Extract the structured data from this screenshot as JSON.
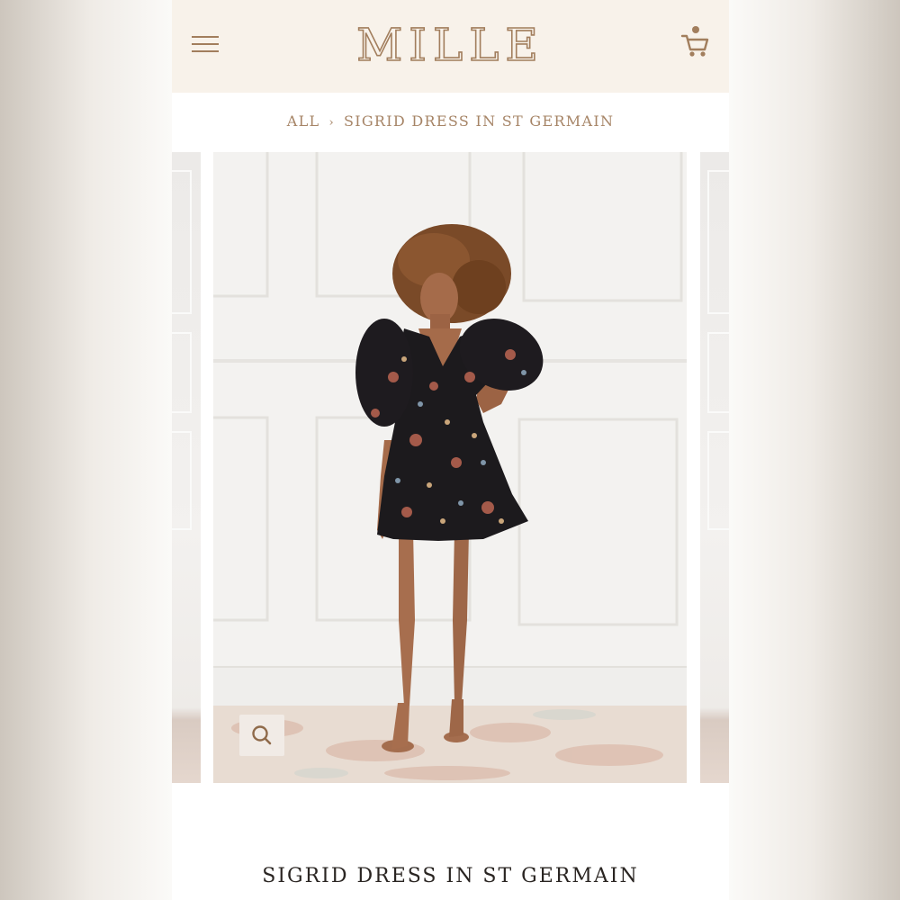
{
  "header": {
    "brand": "MILLE",
    "menu_icon": "hamburger-menu-icon",
    "cart_icon": "shopping-cart-icon"
  },
  "breadcrumb": {
    "root": "ALL",
    "separator": "›",
    "current": "SIGRID DRESS IN ST GERMAIN"
  },
  "gallery": {
    "zoom_icon": "magnify-icon"
  },
  "product": {
    "title": "SIGRID DRESS IN ST GERMAIN"
  },
  "colors": {
    "accent": "#a27e5d",
    "header_bg": "#f8f2ea",
    "text_dark": "#2a2522"
  }
}
